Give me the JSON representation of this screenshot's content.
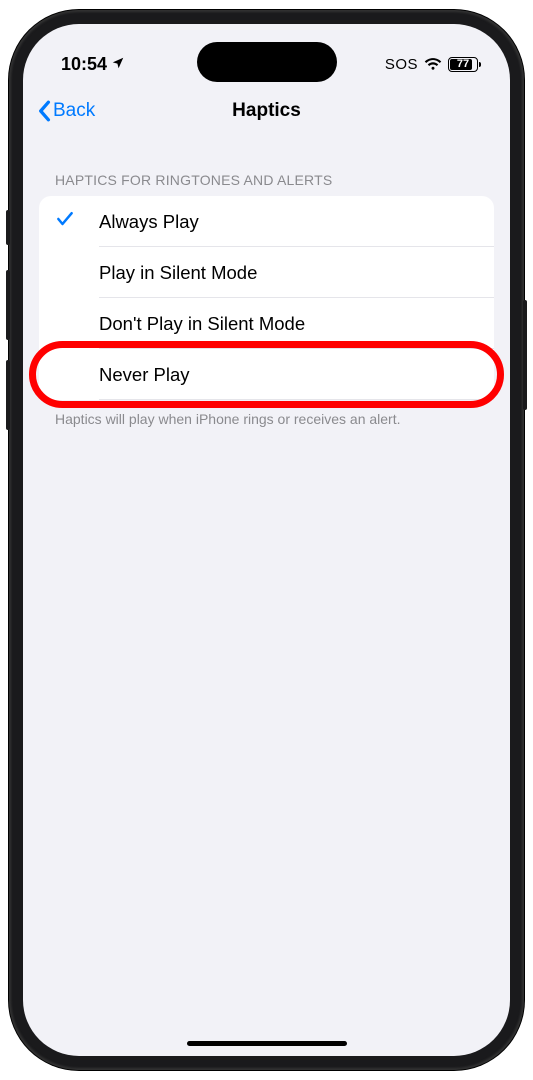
{
  "status": {
    "time": "10:54",
    "sos": "SOS",
    "battery_pct": "77"
  },
  "nav": {
    "back_label": "Back",
    "title": "Haptics"
  },
  "section": {
    "header": "HAPTICS FOR RINGTONES AND ALERTS",
    "footer": "Haptics will play when iPhone rings or receives an alert."
  },
  "options": [
    {
      "label": "Always Play",
      "selected": true
    },
    {
      "label": "Play in Silent Mode",
      "selected": false
    },
    {
      "label": "Don't Play in Silent Mode",
      "selected": false
    },
    {
      "label": "Never Play",
      "selected": false,
      "highlighted": true
    }
  ]
}
